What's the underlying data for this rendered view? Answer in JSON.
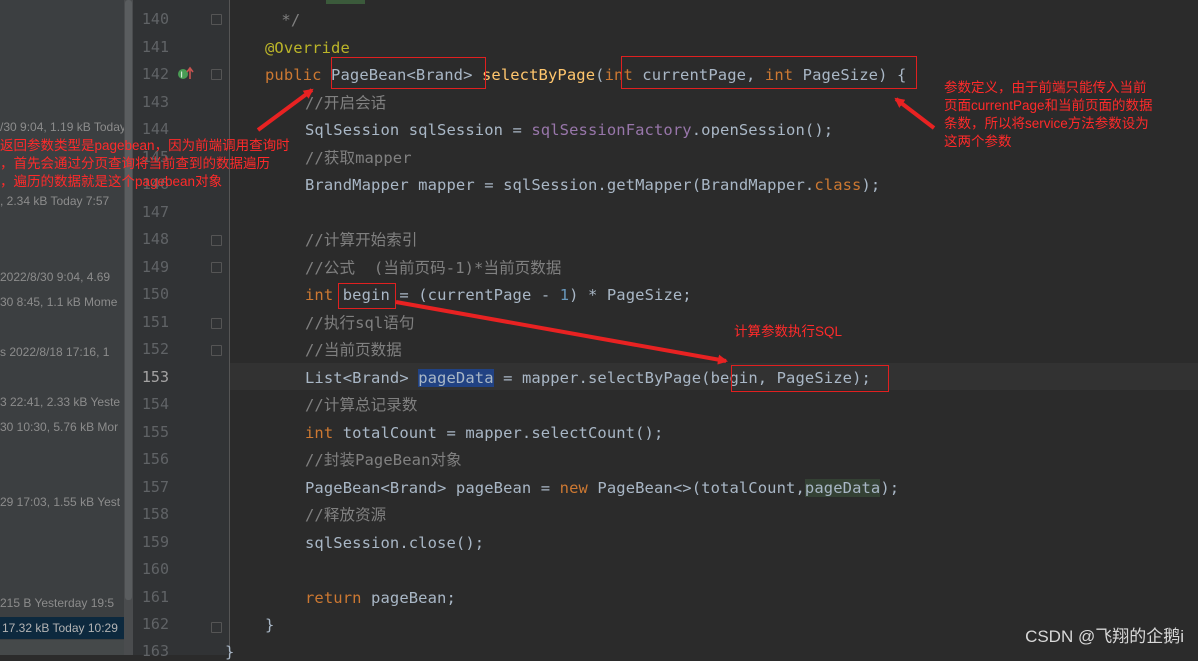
{
  "file_panel": {
    "rows": [
      "/30 9:04, 1.19 kB Today",
      ", 2.34 kB Today 7:57",
      " 2022/8/30 9:04, 4.69",
      "30 8:45, 1.1 kB Mome",
      "s  2022/8/18 17:16, 1",
      "3 22:41, 2.33 kB Yeste",
      "30 10:30, 5.76 kB Mor",
      "29 17:03, 1.55 kB Yest",
      " 215 B Yesterday 19:5",
      "17.32 kB Today 10:29"
    ]
  },
  "line_numbers": [
    "140",
    "141",
    "142",
    "143",
    "144",
    "145",
    "146",
    "147",
    "148",
    "149",
    "150",
    "151",
    "152",
    "153",
    "154",
    "155",
    "156",
    "157",
    "158",
    "159",
    "160",
    "161",
    "162",
    "163"
  ],
  "code": {
    "l140": " */",
    "l141": "@Override",
    "l142_public": "public ",
    "l142_type": "PageBean<Brand>",
    "l142_method": "selectByPage",
    "l142_paren": "(",
    "l142_int1": "int",
    "l142_p1": " currentPage, ",
    "l142_int2": "int",
    "l142_p2": " PageSize) {",
    "l143": "//开启会话",
    "l144_a": "SqlSession sqlSession = ",
    "l144_b": "sqlSessionFactory",
    "l144_c": ".openSession();",
    "l145": "//获取mapper",
    "l146_a": "BrandMapper mapper = sqlSession.getMapper(BrandMapper.",
    "l146_b": "class",
    "l146_c": ");",
    "l148": "//计算开始索引",
    "l149": "//公式  (当前页码-1)*当前页数据",
    "l150_int": "int",
    "l150_begin": "begin",
    "l150_a": " = (currentPage - ",
    "l150_num": "1",
    "l150_b": ") * PageSize;",
    "l151": "//执行sql语句",
    "l152": "//当前页数据",
    "l153_a": "List<Brand> ",
    "l153_sel": "pageData",
    "l153_b": " = mapper.selectByPage(begin, PageSize);",
    "l154": "//计算总记录数",
    "l155_int": "int",
    "l155_a": " totalCount = mapper.selectCount();",
    "l156": "//封装PageBean对象",
    "l157_a": "PageBean<Brand> pageBean = ",
    "l157_new": "new",
    "l157_b": " PageBean<>(totalCount,",
    "l157_c": "pageData",
    "l157_d": ");",
    "l158": "//释放资源",
    "l159": "sqlSession.close();",
    "l161_ret": "return",
    "l161_a": " pageBean;",
    "l162": "}",
    "l163": "}"
  },
  "annotations": {
    "left_note": [
      "返回参数类型是pagebean，因为前端调用查询时",
      "，首先会通过分页查询将当前查到的数据遍历",
      "，遍历的数据就是这个pagebean对象"
    ],
    "right_note": [
      "参数定义，由于前端只能传入当前",
      "页面currentPage和当前页面的数据",
      "条数，所以将service方法参数设为",
      "这两个参数"
    ],
    "mid_note": "计算参数执行SQL"
  },
  "watermark": "CSDN @飞翔的企鹅i",
  "colors": {
    "annotation_red": "#e02020",
    "keyword": "#cc7832",
    "comment": "#808080",
    "method": "#ffc66d"
  }
}
